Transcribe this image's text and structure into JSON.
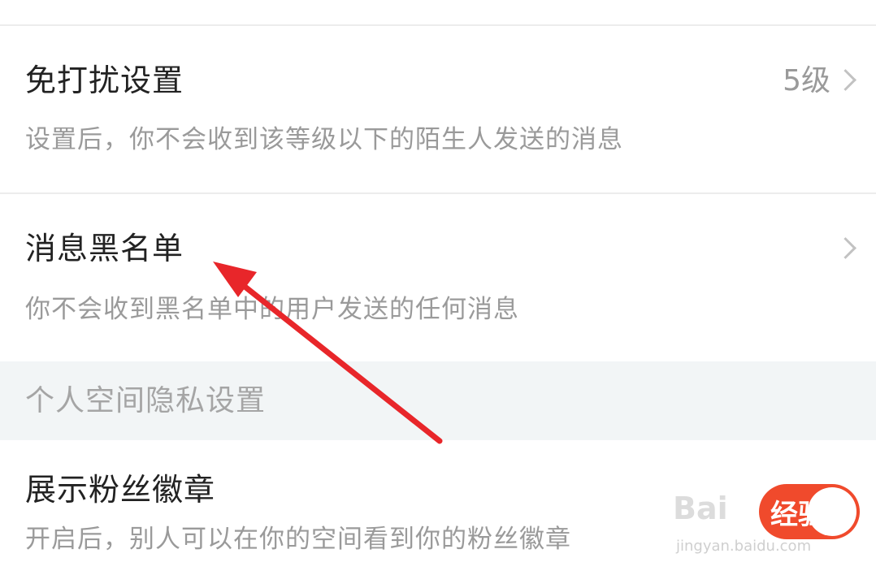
{
  "settings": {
    "dnd": {
      "title": "免打扰设置",
      "value": "5级",
      "description": "设置后，你不会收到该等级以下的陌生人发送的消息"
    },
    "blacklist": {
      "title": "消息黑名单",
      "description": "你不会收到黑名单中的用户发送的任何消息"
    },
    "section_header": "个人空间隐私设置",
    "fan_badge": {
      "title": "展示粉丝徽章",
      "description": "开启后，别人可以在你的空间看到你的粉丝徽章",
      "toggle_on": true
    }
  },
  "watermark": {
    "brand": "Bai",
    "brand_suffix": "经验",
    "url": "jingyan.baidu.com"
  },
  "colors": {
    "accent": "#f04a2c",
    "annotation": "#e8262a"
  },
  "icons": {
    "chevron": "chevron-right-icon"
  }
}
